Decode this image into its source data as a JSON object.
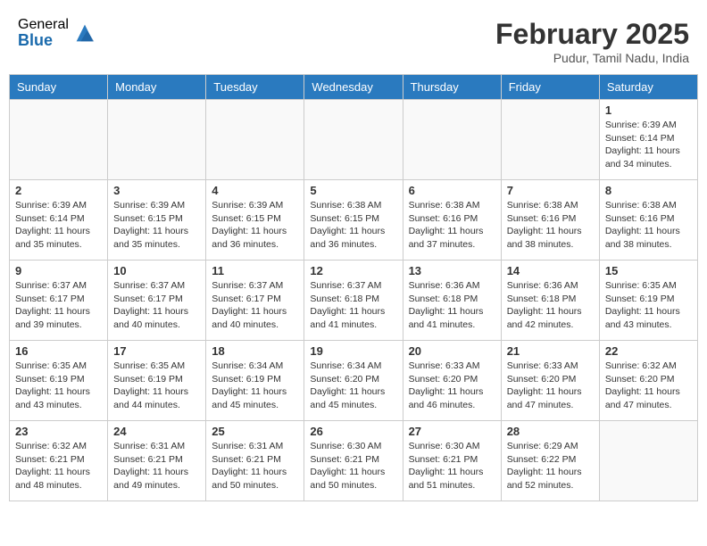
{
  "header": {
    "logo_general": "General",
    "logo_blue": "Blue",
    "month_title": "February 2025",
    "location": "Pudur, Tamil Nadu, India"
  },
  "days_of_week": [
    "Sunday",
    "Monday",
    "Tuesday",
    "Wednesday",
    "Thursday",
    "Friday",
    "Saturday"
  ],
  "weeks": [
    [
      {
        "day": "",
        "info": ""
      },
      {
        "day": "",
        "info": ""
      },
      {
        "day": "",
        "info": ""
      },
      {
        "day": "",
        "info": ""
      },
      {
        "day": "",
        "info": ""
      },
      {
        "day": "",
        "info": ""
      },
      {
        "day": "1",
        "info": "Sunrise: 6:39 AM\nSunset: 6:14 PM\nDaylight: 11 hours\nand 34 minutes."
      }
    ],
    [
      {
        "day": "2",
        "info": "Sunrise: 6:39 AM\nSunset: 6:14 PM\nDaylight: 11 hours\nand 35 minutes."
      },
      {
        "day": "3",
        "info": "Sunrise: 6:39 AM\nSunset: 6:15 PM\nDaylight: 11 hours\nand 35 minutes."
      },
      {
        "day": "4",
        "info": "Sunrise: 6:39 AM\nSunset: 6:15 PM\nDaylight: 11 hours\nand 36 minutes."
      },
      {
        "day": "5",
        "info": "Sunrise: 6:38 AM\nSunset: 6:15 PM\nDaylight: 11 hours\nand 36 minutes."
      },
      {
        "day": "6",
        "info": "Sunrise: 6:38 AM\nSunset: 6:16 PM\nDaylight: 11 hours\nand 37 minutes."
      },
      {
        "day": "7",
        "info": "Sunrise: 6:38 AM\nSunset: 6:16 PM\nDaylight: 11 hours\nand 38 minutes."
      },
      {
        "day": "8",
        "info": "Sunrise: 6:38 AM\nSunset: 6:16 PM\nDaylight: 11 hours\nand 38 minutes."
      }
    ],
    [
      {
        "day": "9",
        "info": "Sunrise: 6:37 AM\nSunset: 6:17 PM\nDaylight: 11 hours\nand 39 minutes."
      },
      {
        "day": "10",
        "info": "Sunrise: 6:37 AM\nSunset: 6:17 PM\nDaylight: 11 hours\nand 40 minutes."
      },
      {
        "day": "11",
        "info": "Sunrise: 6:37 AM\nSunset: 6:17 PM\nDaylight: 11 hours\nand 40 minutes."
      },
      {
        "day": "12",
        "info": "Sunrise: 6:37 AM\nSunset: 6:18 PM\nDaylight: 11 hours\nand 41 minutes."
      },
      {
        "day": "13",
        "info": "Sunrise: 6:36 AM\nSunset: 6:18 PM\nDaylight: 11 hours\nand 41 minutes."
      },
      {
        "day": "14",
        "info": "Sunrise: 6:36 AM\nSunset: 6:18 PM\nDaylight: 11 hours\nand 42 minutes."
      },
      {
        "day": "15",
        "info": "Sunrise: 6:35 AM\nSunset: 6:19 PM\nDaylight: 11 hours\nand 43 minutes."
      }
    ],
    [
      {
        "day": "16",
        "info": "Sunrise: 6:35 AM\nSunset: 6:19 PM\nDaylight: 11 hours\nand 43 minutes."
      },
      {
        "day": "17",
        "info": "Sunrise: 6:35 AM\nSunset: 6:19 PM\nDaylight: 11 hours\nand 44 minutes."
      },
      {
        "day": "18",
        "info": "Sunrise: 6:34 AM\nSunset: 6:19 PM\nDaylight: 11 hours\nand 45 minutes."
      },
      {
        "day": "19",
        "info": "Sunrise: 6:34 AM\nSunset: 6:20 PM\nDaylight: 11 hours\nand 45 minutes."
      },
      {
        "day": "20",
        "info": "Sunrise: 6:33 AM\nSunset: 6:20 PM\nDaylight: 11 hours\nand 46 minutes."
      },
      {
        "day": "21",
        "info": "Sunrise: 6:33 AM\nSunset: 6:20 PM\nDaylight: 11 hours\nand 47 minutes."
      },
      {
        "day": "22",
        "info": "Sunrise: 6:32 AM\nSunset: 6:20 PM\nDaylight: 11 hours\nand 47 minutes."
      }
    ],
    [
      {
        "day": "23",
        "info": "Sunrise: 6:32 AM\nSunset: 6:21 PM\nDaylight: 11 hours\nand 48 minutes."
      },
      {
        "day": "24",
        "info": "Sunrise: 6:31 AM\nSunset: 6:21 PM\nDaylight: 11 hours\nand 49 minutes."
      },
      {
        "day": "25",
        "info": "Sunrise: 6:31 AM\nSunset: 6:21 PM\nDaylight: 11 hours\nand 50 minutes."
      },
      {
        "day": "26",
        "info": "Sunrise: 6:30 AM\nSunset: 6:21 PM\nDaylight: 11 hours\nand 50 minutes."
      },
      {
        "day": "27",
        "info": "Sunrise: 6:30 AM\nSunset: 6:21 PM\nDaylight: 11 hours\nand 51 minutes."
      },
      {
        "day": "28",
        "info": "Sunrise: 6:29 AM\nSunset: 6:22 PM\nDaylight: 11 hours\nand 52 minutes."
      },
      {
        "day": "",
        "info": ""
      }
    ]
  ]
}
